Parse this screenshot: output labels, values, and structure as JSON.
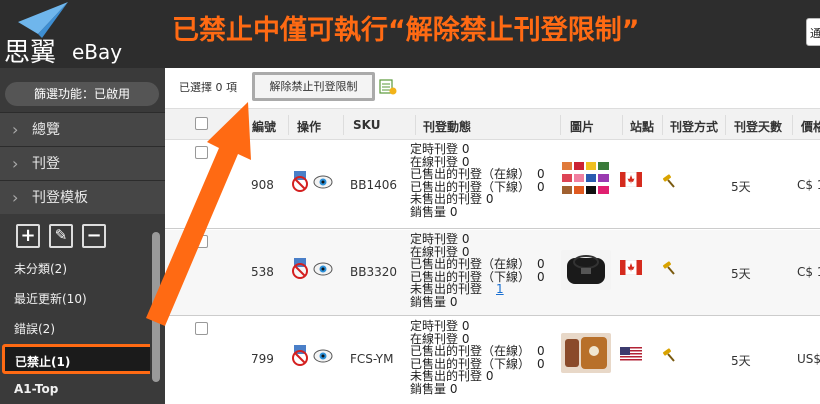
{
  "header": {
    "logo_text": "思翼",
    "logo_sub": "eBay",
    "headline": "已禁止中僅可執行“解除禁止刊登限制”",
    "search_placeholder": "通"
  },
  "sidebar": {
    "filter_status": "篩選功能：已啟用",
    "nav": [
      {
        "label": "總覽"
      },
      {
        "label": "刊登"
      },
      {
        "label": "刊登模板"
      }
    ],
    "tools": [
      "+",
      "✎",
      "−"
    ],
    "categories": [
      {
        "label": "未分類(2)",
        "active": false
      },
      {
        "label": "最近更新(10)",
        "active": false
      },
      {
        "label": "錯誤(2)",
        "active": false
      },
      {
        "label": "已禁止(1)",
        "active": true
      },
      {
        "label": "A1-Top",
        "active": false
      }
    ]
  },
  "toolbar": {
    "selected_label": "已選擇 0 項",
    "unban_label": "解除禁止刊登限制"
  },
  "table": {
    "headers": {
      "code": "編號",
      "action": "操作",
      "sku": "SKU",
      "status": "刊登動態",
      "image": "圖片",
      "site": "站點",
      "method": "刊登方式",
      "days": "刊登天數",
      "price": "價格"
    },
    "rows": [
      {
        "code": "908",
        "sku": "BB1406",
        "status": [
          {
            "label": "定時刊登",
            "value": "0"
          },
          {
            "label": "在線刊登",
            "value": "0"
          },
          {
            "label": "已售出的刊登（在線）",
            "value": "0"
          },
          {
            "label": "已售出的刊登（下線）",
            "value": "0"
          },
          {
            "label": "未售出的刊登",
            "value": "0"
          },
          {
            "label": "銷售量",
            "value": "0"
          }
        ],
        "site": "canada",
        "days": "5天",
        "price": "C$ 1"
      },
      {
        "code": "538",
        "sku": "BB3320",
        "status": [
          {
            "label": "定時刊登",
            "value": "0"
          },
          {
            "label": "在線刊登",
            "value": "0"
          },
          {
            "label": "已售出的刊登（在線）",
            "value": "0"
          },
          {
            "label": "已售出的刊登（下線）",
            "value": "0"
          },
          {
            "label": "未售出的刊登",
            "value": "1",
            "link": true
          },
          {
            "label": "銷售量",
            "value": "0"
          }
        ],
        "site": "canada",
        "days": "5天",
        "price": "C$ 1"
      },
      {
        "code": "799",
        "sku": "FCS-YM",
        "status": [
          {
            "label": "定時刊登",
            "value": "0"
          },
          {
            "label": "在線刊登",
            "value": "0"
          },
          {
            "label": "已售出的刊登（在線）",
            "value": "0"
          },
          {
            "label": "已售出的刊登（下線）",
            "value": "0"
          },
          {
            "label": "未售出的刊登",
            "value": "0"
          },
          {
            "label": "銷售量",
            "value": "0"
          }
        ],
        "site": "usa",
        "days": "5天",
        "price": "US$"
      }
    ]
  },
  "colors": {
    "accent": "#ff6a13",
    "sidebar_bg": "#3a3a3a",
    "header_bg": "#2d2d2d",
    "link": "#1a6fd1"
  },
  "icons": {
    "row_actions": [
      "ban-icon",
      "eye-icon"
    ],
    "method": "hammer-icon",
    "toolbar": "excel-export-icon"
  }
}
